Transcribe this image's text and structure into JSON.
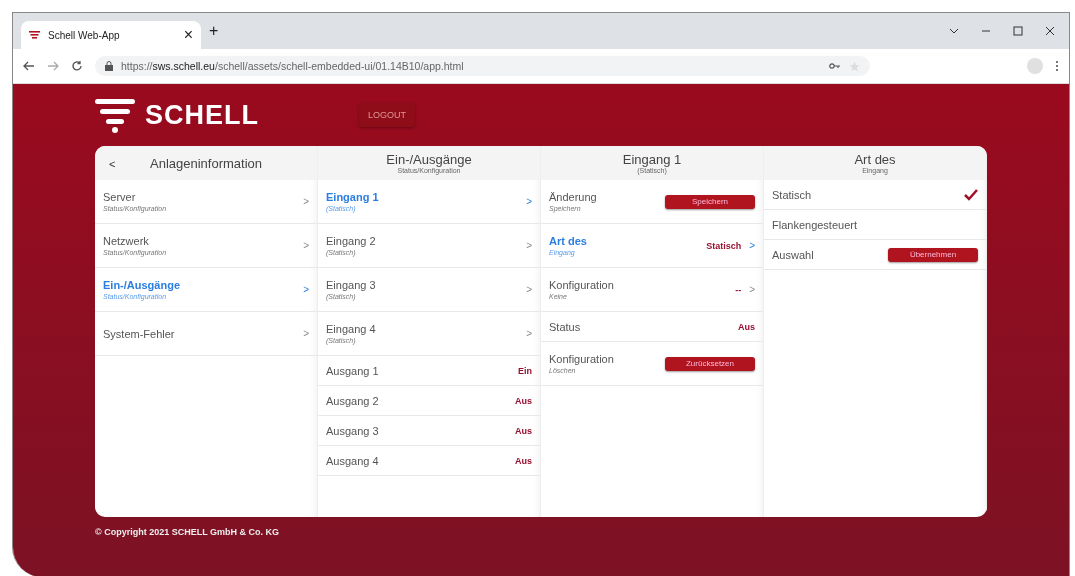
{
  "browser": {
    "tab_title": "Schell Web-App",
    "tab_close": "×",
    "new_tab": "+",
    "url_prefix": "https://",
    "url_host": "sws.schell.eu",
    "url_path": "/schell/assets/schell-embedded-ui/01.14B10/app.html"
  },
  "header": {
    "logo_text": "SCHELL",
    "logout": "LOGOUT"
  },
  "columns": [
    {
      "back": "<",
      "title": "Anlageninformation",
      "rows": [
        {
          "kind": "nav",
          "title": "Server",
          "subtitle": "Status/Konfiguration",
          "arrow": ">",
          "selected": false
        },
        {
          "kind": "nav",
          "title": "Netzwerk",
          "subtitle": "Status/Konfiguration",
          "arrow": ">",
          "selected": false
        },
        {
          "kind": "nav",
          "title": "Ein-/Ausgänge",
          "subtitle": "Status/Konfiguration",
          "arrow": ">",
          "selected": true
        },
        {
          "kind": "nav",
          "title": "System-Fehler",
          "arrow": ">",
          "selected": false
        }
      ]
    },
    {
      "title": "Ein-/Ausgänge",
      "subtitle": "Status/Konfiguration",
      "rows": [
        {
          "kind": "nav",
          "title": "Eingang 1",
          "subtitle": "(Statisch)",
          "arrow": ">",
          "selected": true
        },
        {
          "kind": "nav",
          "title": "Eingang 2",
          "subtitle": "(Statisch)",
          "arrow": ">",
          "selected": false
        },
        {
          "kind": "nav",
          "title": "Eingang 3",
          "subtitle": "(Statisch)",
          "arrow": ">",
          "selected": false
        },
        {
          "kind": "nav",
          "title": "Eingang 4",
          "subtitle": "(Statisch)",
          "arrow": ">",
          "selected": false
        },
        {
          "kind": "value",
          "title": "Ausgang 1",
          "value": "Ein"
        },
        {
          "kind": "value",
          "title": "Ausgang 2",
          "value": "Aus"
        },
        {
          "kind": "value",
          "title": "Ausgang 3",
          "value": "Aus"
        },
        {
          "kind": "value",
          "title": "Ausgang 4",
          "value": "Aus"
        }
      ]
    },
    {
      "title": "Eingang 1",
      "subtitle": "(Statisch)",
      "rows": [
        {
          "kind": "action",
          "title": "Änderung",
          "subtitle": "Speichern",
          "button": "Speichern"
        },
        {
          "kind": "nav",
          "title": "Art des",
          "subtitle": "Eingang",
          "value": "Statisch",
          "arrow": ">",
          "selected": true
        },
        {
          "kind": "nav",
          "title": "Konfiguration",
          "subtitle": "Keine",
          "value": "--",
          "arrow": ">",
          "selected": false
        },
        {
          "kind": "value",
          "title": "Status",
          "value": "Aus"
        },
        {
          "kind": "action",
          "title": "Konfiguration",
          "subtitle": "Löschen",
          "button": "Zurücksetzen"
        }
      ]
    },
    {
      "title": "Art des",
      "subtitle": "Eingang",
      "rows": [
        {
          "kind": "option",
          "title": "Statisch",
          "checked": true
        },
        {
          "kind": "option",
          "title": "Flankengesteuert",
          "checked": false
        },
        {
          "kind": "action",
          "title": "Auswahl",
          "button": "Übernehmen"
        }
      ]
    }
  ],
  "footer": "© Copyright 2021 SCHELL GmbH & Co. KG"
}
